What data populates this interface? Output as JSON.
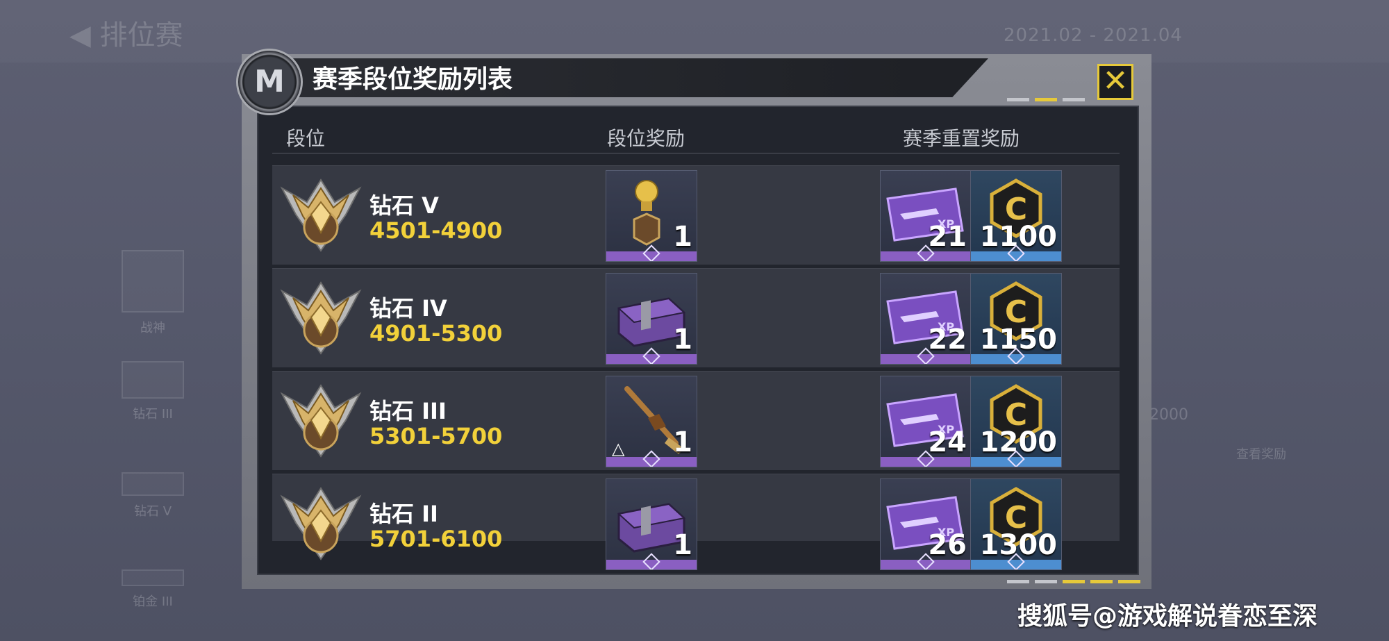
{
  "background": {
    "back_title": "排位赛",
    "season_range": "2021.02 - 2021.04",
    "side_items": [
      "战神",
      "钻石 III",
      "钻石 V",
      "铂金 III"
    ],
    "right_text": "2000",
    "right_label": "查看奖励"
  },
  "modal": {
    "title": "赛季段位奖励列表",
    "emblem_glyph": "M",
    "close_symbol": "✕",
    "headers": {
      "rank": "段位",
      "rank_reward": "段位奖励",
      "reset_reward": "赛季重置奖励"
    }
  },
  "rows": [
    {
      "name": "钻石 V",
      "range": "4501-4900",
      "roman": "V",
      "rank_reward_qty": "1",
      "rank_reward_item": "medal-badge",
      "xp_qty": "21",
      "coin_qty": "1100"
    },
    {
      "name": "钻石 IV",
      "range": "4901-5300",
      "roman": "IV",
      "rank_reward_qty": "1",
      "rank_reward_item": "crate",
      "xp_qty": "22",
      "coin_qty": "1150"
    },
    {
      "name": "钻石 III",
      "range": "5301-5700",
      "roman": "III",
      "rank_reward_qty": "1",
      "rank_reward_item": "rifle-blueprint",
      "xp_qty": "24",
      "coin_qty": "1200"
    },
    {
      "name": "钻石 II",
      "range": "5701-6100",
      "roman": "II",
      "rank_reward_qty": "1",
      "rank_reward_item": "crate",
      "xp_qty": "26",
      "coin_qty": "1300"
    }
  ],
  "watermark": "搜狐号@游戏解说眷恋至深",
  "colors": {
    "accent_yellow": "#f2d13a",
    "purple": "#8a5fc2",
    "blue": "#4d8ed0"
  }
}
